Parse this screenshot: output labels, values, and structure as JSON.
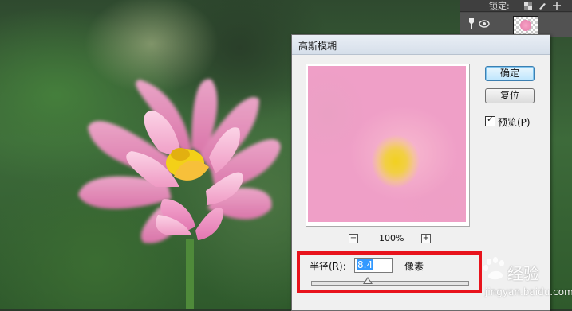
{
  "dialog": {
    "title": "高斯模糊",
    "ok_label": "确定",
    "reset_label": "复位",
    "preview_label": "预览(P)",
    "preview_checked": true,
    "zoom_out": "−",
    "zoom_in": "+",
    "zoom_level": "100%",
    "radius_label": "半径(R):",
    "radius_value": "8.4",
    "radius_unit": "像素",
    "radius_slider_fraction": 0.36
  },
  "layers_panel": {
    "lock_label": "锁定:"
  },
  "watermark": {
    "text": "经验",
    "url": "jingyan.baidu.com"
  }
}
